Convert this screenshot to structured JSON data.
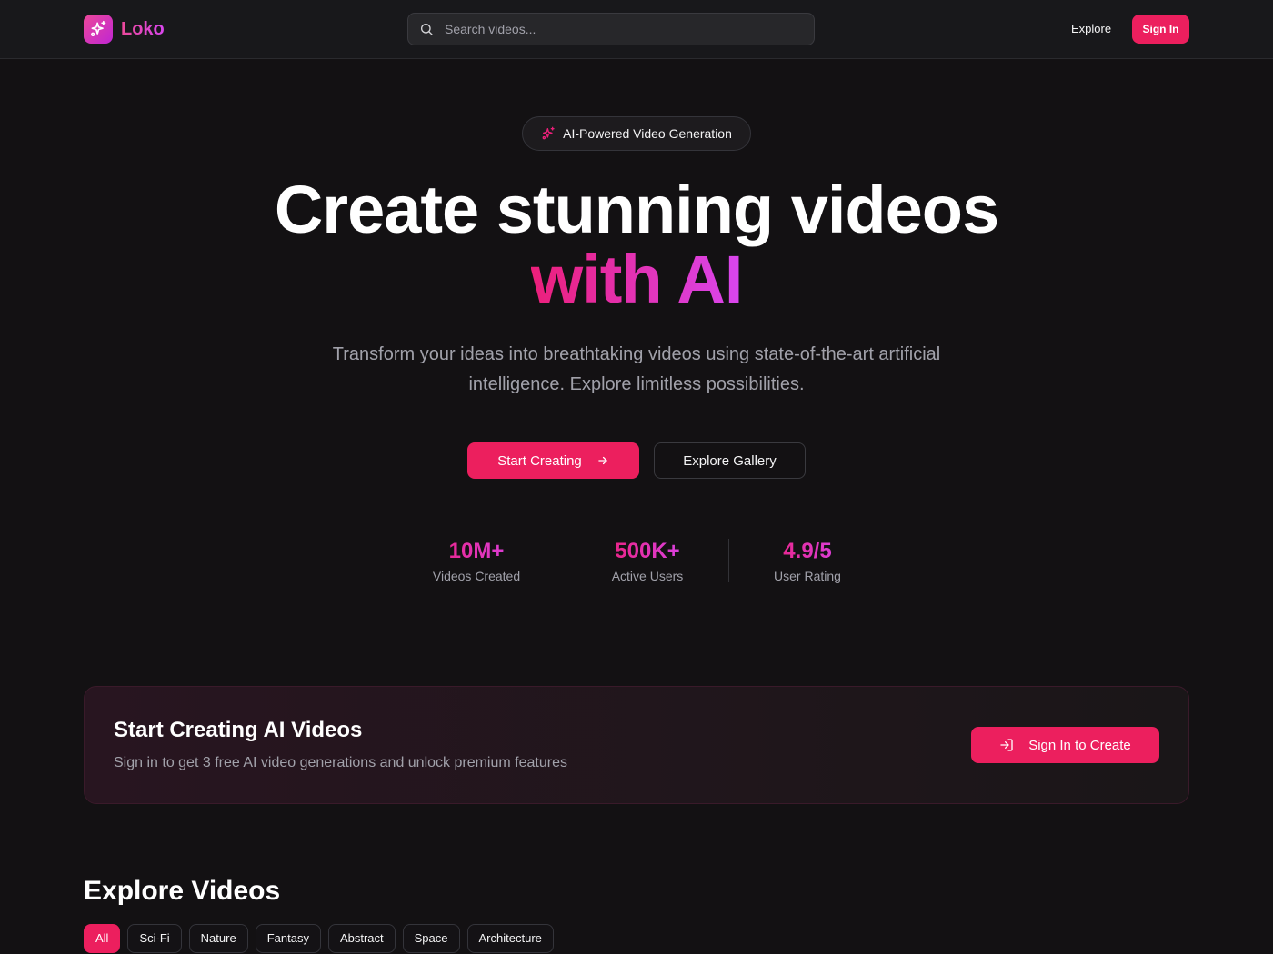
{
  "header": {
    "brand": "Loko",
    "search_placeholder": "Search videos...",
    "nav_explore": "Explore",
    "signin_label": "Sign In"
  },
  "hero": {
    "badge": "AI-Powered Video Generation",
    "title_line1": "Create stunning videos",
    "title_line2": "with AI",
    "subtitle": "Transform your ideas into breathtaking videos using state-of-the-art artificial intelligence. Explore limitless possibilities.",
    "primary_cta": "Start Creating",
    "secondary_cta": "Explore Gallery"
  },
  "stats": [
    {
      "value": "10M+",
      "label": "Videos Created"
    },
    {
      "value": "500K+",
      "label": "Active Users"
    },
    {
      "value": "4.9/5",
      "label": "User Rating"
    }
  ],
  "cta_card": {
    "title": "Start Creating AI Videos",
    "subtitle": "Sign in to get 3 free AI video generations and unlock premium features",
    "button": "Sign In to Create"
  },
  "explore": {
    "title": "Explore Videos",
    "filters": [
      "All",
      "Sci-Fi",
      "Nature",
      "Fantasy",
      "Abstract",
      "Space",
      "Architecture"
    ],
    "active_filter": "All"
  },
  "colors": {
    "accent": "#ec1f5e",
    "gradient_start": "#ec1f7a",
    "gradient_end": "#d946ef",
    "background": "#131113"
  }
}
